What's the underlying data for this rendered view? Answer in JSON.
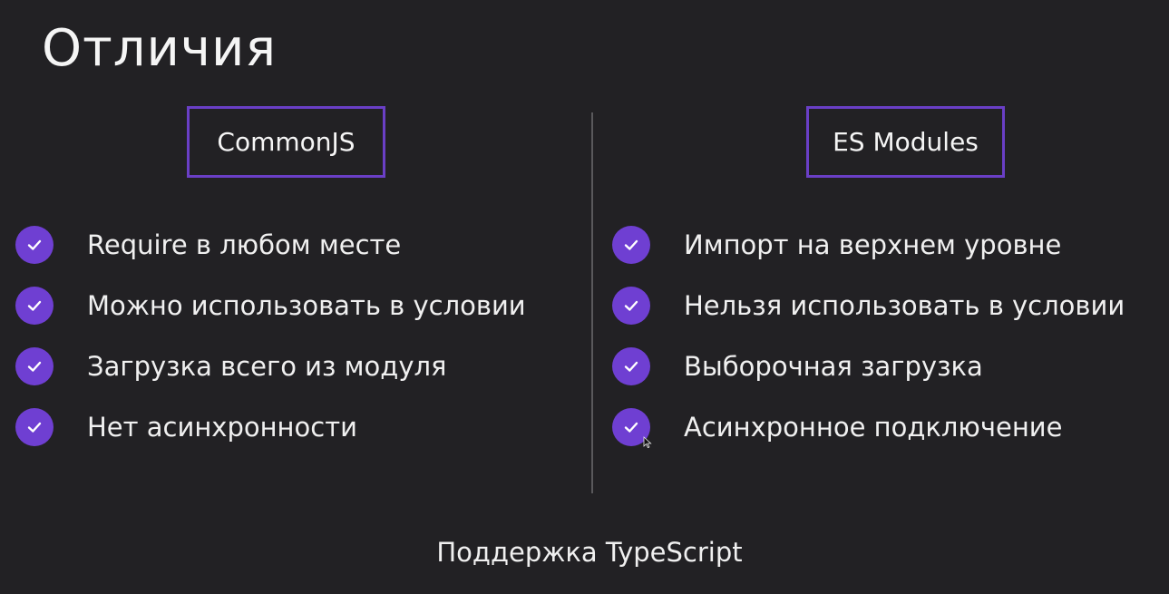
{
  "slide": {
    "title": "Отличия",
    "footer": "Поддержка TypeScript"
  },
  "columns": [
    {
      "header": "CommonJS",
      "items": [
        "Require в любом месте",
        "Можно использовать в условии",
        "Загрузка всего из модуля",
        "Нет асинхронности"
      ]
    },
    {
      "header": "ES Modules",
      "items": [
        "Импорт на верхнем уровне",
        "Нельзя использовать в условии",
        "Выборочная загрузка",
        "Асинхронное подключение"
      ]
    }
  ],
  "icons": {
    "check": "check-icon",
    "cursor": "mouse-cursor-icon"
  },
  "colors": {
    "background": "#222124",
    "accent": "#6f3fd2",
    "header_border": "#6a3fc6",
    "divider": "#5a595c",
    "text": "#f0f0f0"
  }
}
